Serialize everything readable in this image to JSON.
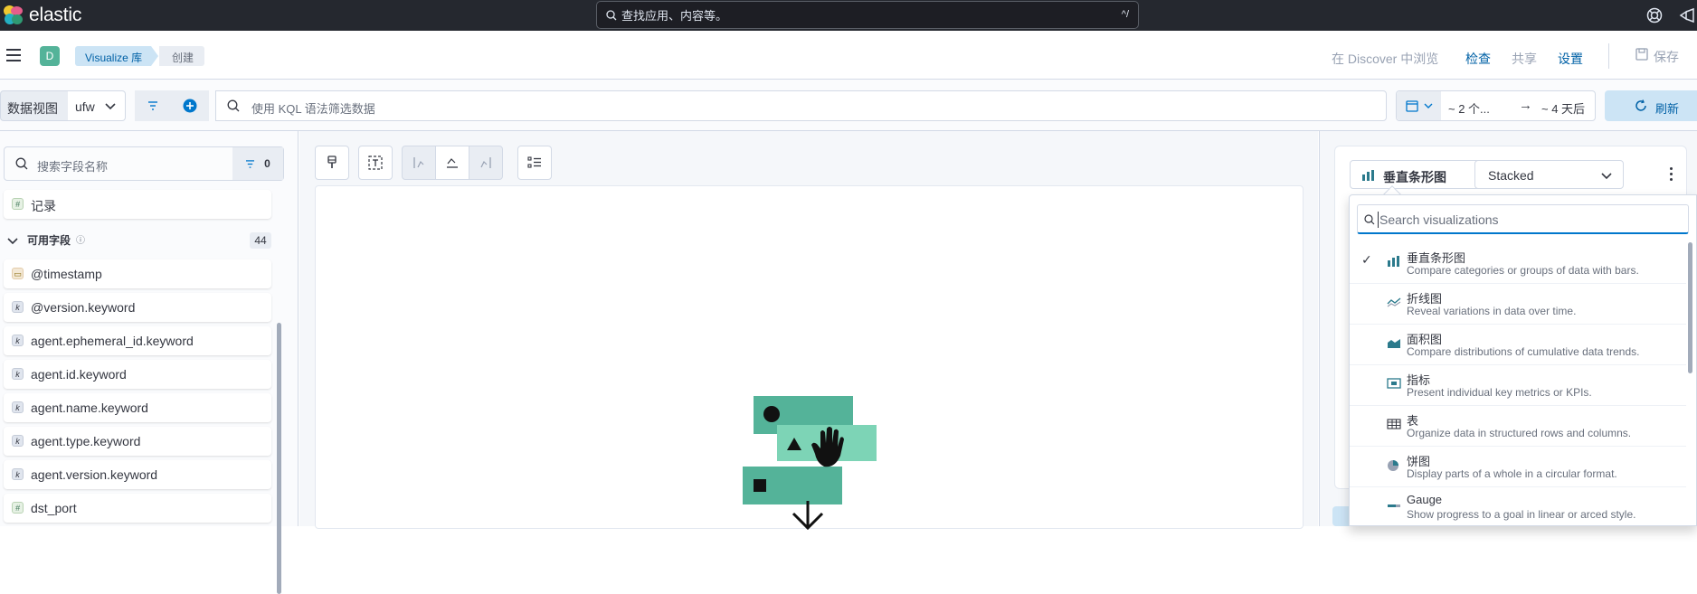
{
  "app": {
    "brand": "elastic",
    "global_search_placeholder": "查找应用、内容等。",
    "global_search_shortcut": "^/"
  },
  "header": {
    "space_badge": "D",
    "breadcrumbs": [
      "Visualize 库",
      "创建"
    ],
    "actions": {
      "discover": "在 Discover 中浏览",
      "inspect": "检查",
      "share": "共享",
      "settings": "设置",
      "save": "保存"
    }
  },
  "query_bar": {
    "data_view_label": "数据视图",
    "data_view_value": "ufw",
    "kql_placeholder": "使用 KQL 语法筛选数据",
    "time_start": "~ 2 个...",
    "time_end": "~ 4 天后",
    "refresh_label": "刷新"
  },
  "field_list": {
    "search_placeholder": "搜索字段名称",
    "filter_count": "0",
    "records_label": "记录",
    "available_label": "可用字段",
    "available_count": "44",
    "fields": [
      {
        "name": "@timestamp",
        "type": "d"
      },
      {
        "name": "@version.keyword",
        "type": "k"
      },
      {
        "name": "agent.ephemeral_id.keyword",
        "type": "k"
      },
      {
        "name": "agent.id.keyword",
        "type": "k"
      },
      {
        "name": "agent.name.keyword",
        "type": "k"
      },
      {
        "name": "agent.type.keyword",
        "type": "k"
      },
      {
        "name": "agent.version.keyword",
        "type": "k"
      },
      {
        "name": "dst_port",
        "type": "n"
      }
    ]
  },
  "config": {
    "viz_type_selected": "垂直条形图",
    "stack_mode": "Stacked",
    "search_placeholder": "Search visualizations",
    "options": [
      {
        "title": "垂直条形图",
        "desc": "Compare categories or groups of data with bars.",
        "icon": "bar-vertical-icon",
        "checked": true
      },
      {
        "title": "折线图",
        "desc": "Reveal variations in data over time.",
        "icon": "line-chart-icon",
        "checked": false
      },
      {
        "title": "面积图",
        "desc": "Compare distributions of cumulative data trends.",
        "icon": "area-chart-icon",
        "checked": false
      },
      {
        "title": "指标",
        "desc": "Present individual key metrics or KPIs.",
        "icon": "metric-icon",
        "checked": false
      },
      {
        "title": "表",
        "desc": "Organize data in structured rows and columns.",
        "icon": "table-icon",
        "checked": false
      },
      {
        "title": "饼图",
        "desc": "Display parts of a whole in a circular format.",
        "icon": "pie-chart-icon",
        "checked": false
      },
      {
        "title": "Gauge",
        "desc": "Show progress to a goal in linear or arced style.",
        "icon": "gauge-icon",
        "checked": false
      }
    ]
  },
  "colors": {
    "accent": "#0077cc",
    "teal": "#54b399",
    "dark": "#25282f"
  }
}
